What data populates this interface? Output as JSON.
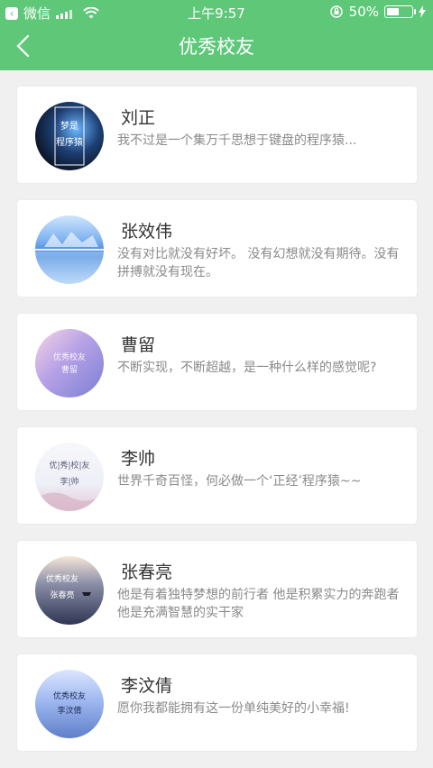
{
  "status_bar": {
    "carrier": "微信",
    "time": "上午9:57",
    "battery": "50%"
  },
  "header": {
    "title": "优秀校友"
  },
  "alumni": [
    {
      "name": "刘正",
      "bio": "我不过是一个集万千思想于键盘的程序猿..."
    },
    {
      "name": "张效伟",
      "bio": "没有对比就没有好坏。 没有幻想就没有期待。没有拼搏就没有现在。"
    },
    {
      "name": "曹留",
      "bio": "不断实现，不断超越，是一种什么样的感觉呢?"
    },
    {
      "name": "李帅",
      "bio": "世界千奇百怪，何必做一个‘正经’程序猿~~"
    },
    {
      "name": "张春亮",
      "bio": "他是有着独特梦想的前行者 他是积累实力的奔跑者 他是充满智慧的实干家"
    },
    {
      "name": "李汶倩",
      "bio": "愿你我都能拥有这一份单纯美好的小幸福!"
    }
  ],
  "avatar_texts": [
    {
      "line1": "梦是",
      "line2": "程序猿"
    },
    {
      "line1": "",
      "line2": ""
    },
    {
      "line1": "优秀校友",
      "line2": "曹留"
    },
    {
      "line1": "优|秀|校|友",
      "line2": "李|帅"
    },
    {
      "line1": "优秀校友",
      "line2": "张春亮"
    },
    {
      "line1": "优秀校友",
      "line2": "李汶倩"
    }
  ],
  "colors": {
    "header_green": "#5fc878",
    "page_background": "#f0f0f0",
    "name_text": "#333333",
    "bio_text": "#8a8a8a"
  }
}
